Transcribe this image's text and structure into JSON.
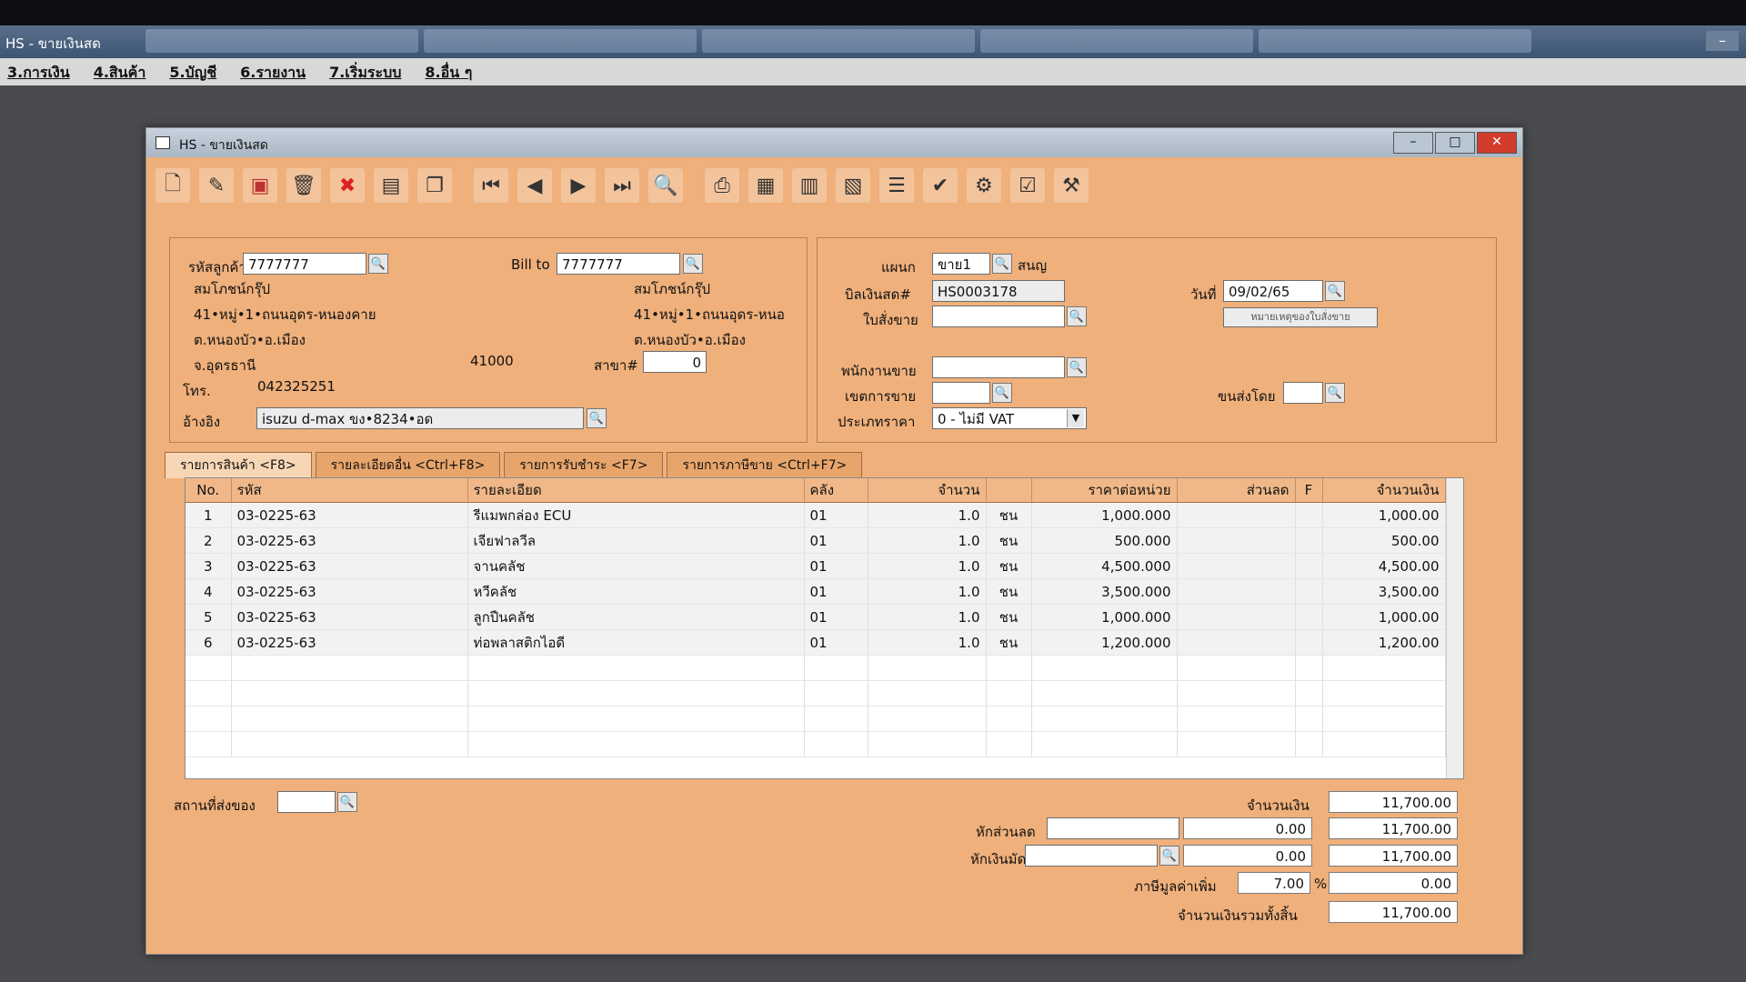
{
  "app": {
    "title": "HS - ขายเงินสด",
    "menu": [
      "3.การเงิน",
      "4.สินค้า",
      "5.บัญชี",
      "6.รายงาน",
      "7.เริ่มระบบ",
      "8.อื่น ๆ"
    ]
  },
  "window": {
    "title": "HS - ขายเงินสด"
  },
  "customer": {
    "code_label": "รหัสลูกค้า",
    "code": "7777777",
    "name": "สมโภชน์กรุ๊ป",
    "addr1": "41•หมู่•1•ถนนอุดร-หนองคาย",
    "addr2": "ต.หนองบัว•อ.เมือง",
    "addr3": "จ.อุดรธานี",
    "postcode": "41000",
    "phone_label": "โทร.",
    "phone": "042325251",
    "ref_label": "อ้างอิง",
    "ref": "isuzu d-max ขง•8234•อด"
  },
  "bill_to": {
    "label": "Bill to",
    "code": "7777777",
    "name": "สมโภชน์กรุ๊ป",
    "addr1": "41•หมู่•1•ถนนอุดร-หนอ",
    "addr2": "ต.หนองบัว•อ.เมือง",
    "branch_label": "สาขา#",
    "branch": "0"
  },
  "header": {
    "dept_label": "แผนก",
    "dept": "ขาย1",
    "dept_name": "สนญ",
    "bill_no_label": "บิลเงินสด#",
    "bill_no": "HS0003178",
    "date_label": "วันที่",
    "date": "09/02/65",
    "so_label": "ใบสั่งขาย",
    "so": "",
    "so_note_btn": "หมายเหตุของใบสั่งขาย",
    "salesman_label": "พนักงานขาย",
    "area_label": "เขตการขาย",
    "shipper_label": "ขนส่งโดย",
    "price_type_label": "ประเภทราคา",
    "price_type": "0 - ไม่มี VAT"
  },
  "tabs": [
    "รายการสินค้า <F8>",
    "รายละเอียดอื่น <Ctrl+F8>",
    "รายการรับชำระ <F7>",
    "รายการภาษีขาย <Ctrl+F7>"
  ],
  "table": {
    "columns": [
      "No.",
      "รหัส",
      "รายละเอียด",
      "คลัง",
      "จำนวน",
      "",
      "ราคาต่อหน่วย",
      "ส่วนลด",
      "F",
      "จำนวนเงิน"
    ],
    "rows": [
      [
        "1",
        "03-0225-63",
        "รีแมพกล่อง ECU",
        "01",
        "1.0",
        "ชน",
        "1,000.000",
        "",
        "",
        "1,000.00"
      ],
      [
        "2",
        "03-0225-63",
        "เจียฟาลวีล",
        "01",
        "1.0",
        "ชน",
        "500.000",
        "",
        "",
        "500.00"
      ],
      [
        "3",
        "03-0225-63",
        "จานคลัช",
        "01",
        "1.0",
        "ชน",
        "4,500.000",
        "",
        "",
        "4,500.00"
      ],
      [
        "4",
        "03-0225-63",
        "หวีคลัช",
        "01",
        "1.0",
        "ชน",
        "3,500.000",
        "",
        "",
        "3,500.00"
      ],
      [
        "5",
        "03-0225-63",
        "ลูกปืนคลัช",
        "01",
        "1.0",
        "ชน",
        "1,000.000",
        "",
        "",
        "1,000.00"
      ],
      [
        "6",
        "03-0225-63",
        "ท่อพลาสติกไอดี",
        "01",
        "1.0",
        "ชน",
        "1,200.000",
        "",
        "",
        "1,200.00"
      ]
    ]
  },
  "footer": {
    "ship_place_label": "สถานที่ส่งของ",
    "amount_label": "จำนวนเงิน",
    "amount": "11,700.00",
    "discount_label": "หักส่วนลด",
    "discount": "0.00",
    "after_discount": "11,700.00",
    "deposit_label": "หักเงินมัดจำ",
    "deposit": "0.00",
    "after_deposit": "11,700.00",
    "vat_label": "ภาษีมูลค่าเพิ่ม",
    "vat_rate": "7.00",
    "vat_pct": "%",
    "vat_amount": "0.00",
    "grand_total_label": "จำนวนเงินรวมทั้งสิ้น",
    "grand_total": "11,700.00"
  }
}
